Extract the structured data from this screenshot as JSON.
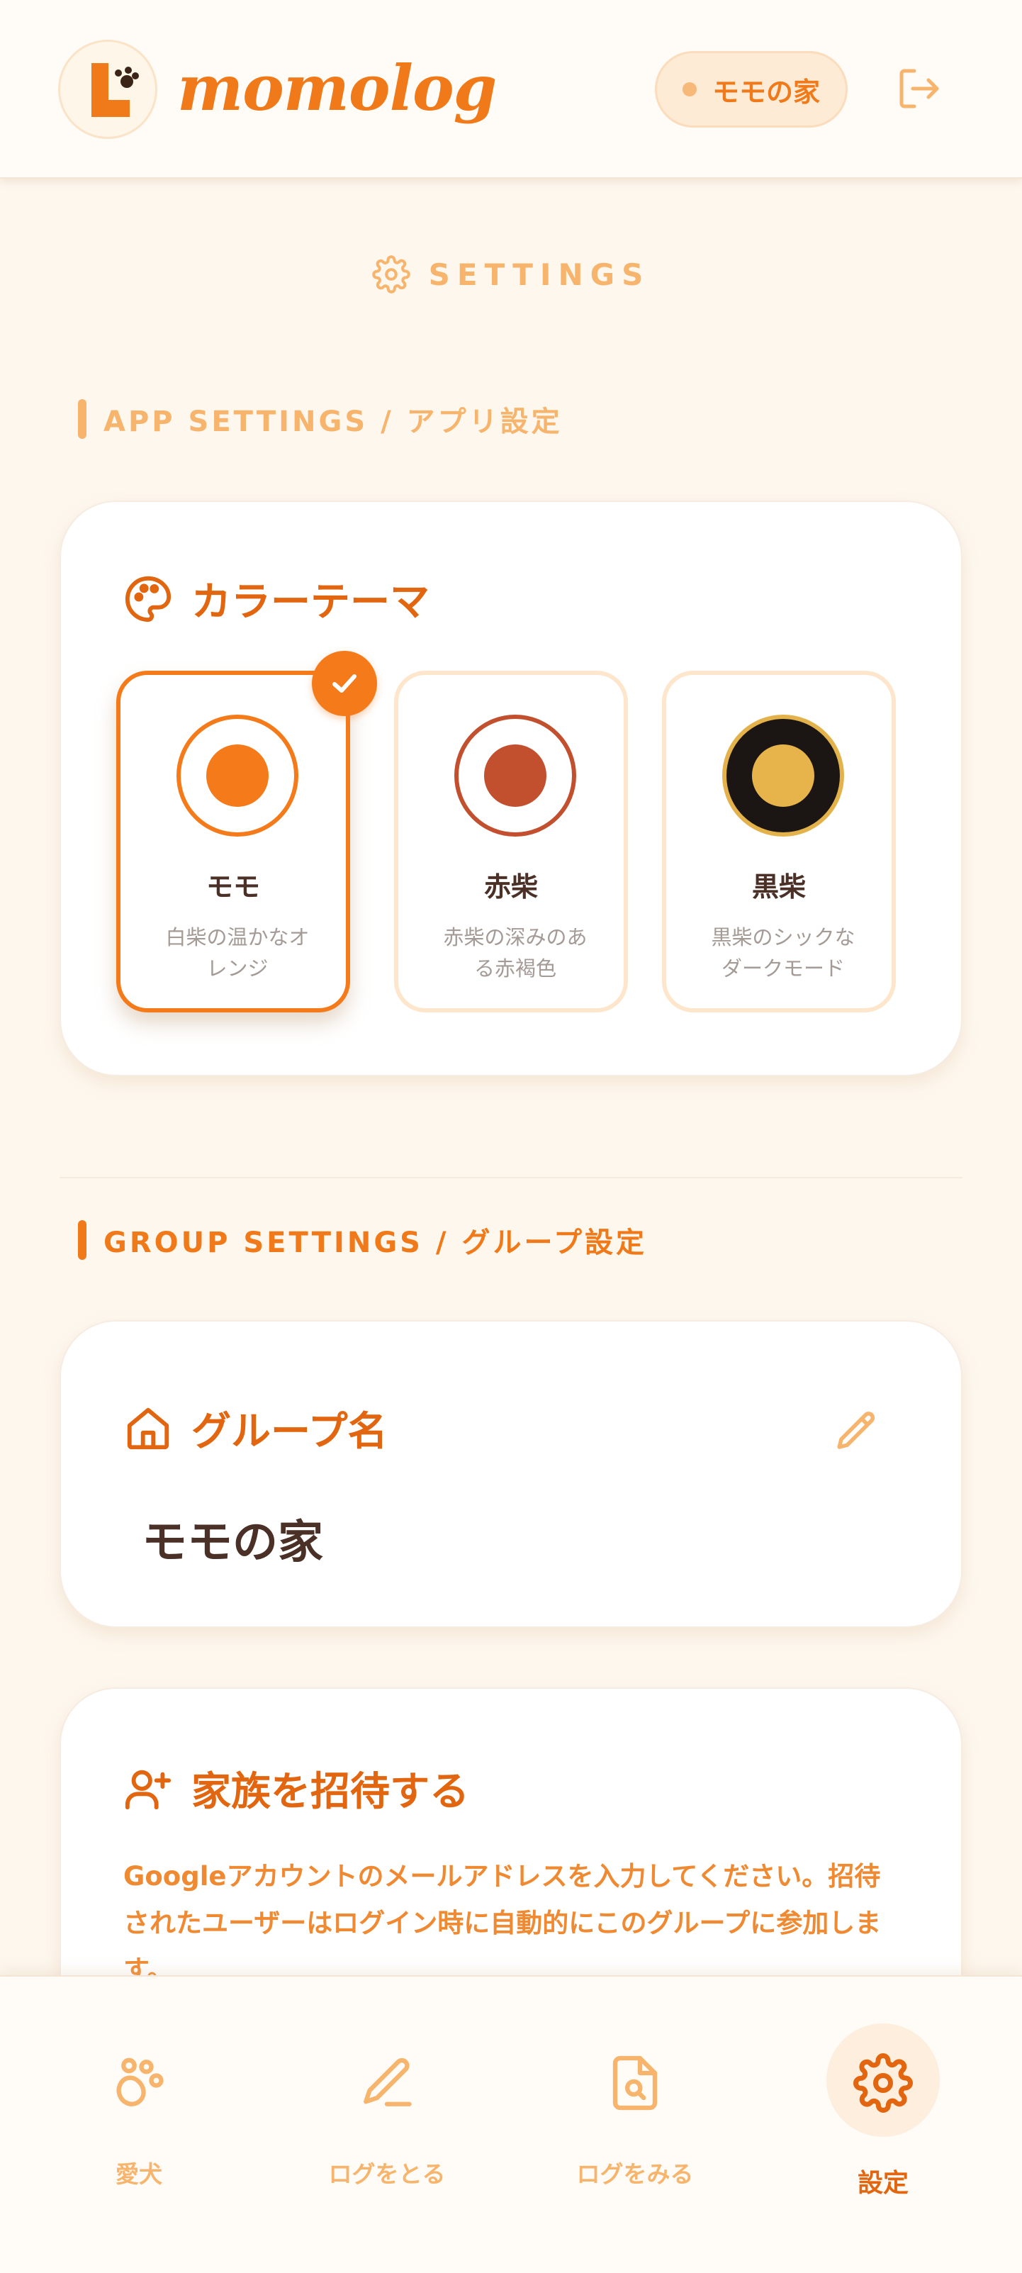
{
  "header": {
    "brand": "momolog",
    "group_badge": "モモの家"
  },
  "page_title": "SETTINGS",
  "app_settings": {
    "heading": "APP SETTINGS / アプリ設定",
    "card_title": "カラーテーマ",
    "themes": [
      {
        "name": "モモ",
        "desc": "白柴の温かなオレンジ",
        "selected": true,
        "ring": "#f47a1a",
        "fill": "#f47a1a",
        "bg": "#ffffff"
      },
      {
        "name": "赤柴",
        "desc": "赤柴の深みのある赤褐色",
        "selected": false,
        "ring": "#c2502f",
        "fill": "#c2502f",
        "bg": "#ffffff"
      },
      {
        "name": "黒柴",
        "desc": "黒柴のシックなダークモード",
        "selected": false,
        "ring": "#e4b24a",
        "fill": "#e7b44b",
        "bg": "#1b1613"
      }
    ]
  },
  "group_settings": {
    "heading": "GROUP SETTINGS / グループ設定",
    "group_name_title": "グループ名",
    "group_name_value": "モモの家",
    "invite_title": "家族を招待する",
    "invite_desc": "Googleアカウントのメールアドレスを入力してください。招待されたユーザーはログイン時に自動的にこのグループに参加します。"
  },
  "bottom_nav": [
    {
      "label": "愛犬",
      "icon": "paw-icon",
      "active": false
    },
    {
      "label": "ログをとる",
      "icon": "pencil-icon",
      "active": false
    },
    {
      "label": "ログをみる",
      "icon": "document-search-icon",
      "active": false
    },
    {
      "label": "設定",
      "icon": "gear-icon",
      "active": true
    }
  ],
  "colors": {
    "accent": "#f07a1a",
    "accent_light": "#f7b46c",
    "background": "#fdf7ee",
    "text_dark": "#4a3026"
  }
}
